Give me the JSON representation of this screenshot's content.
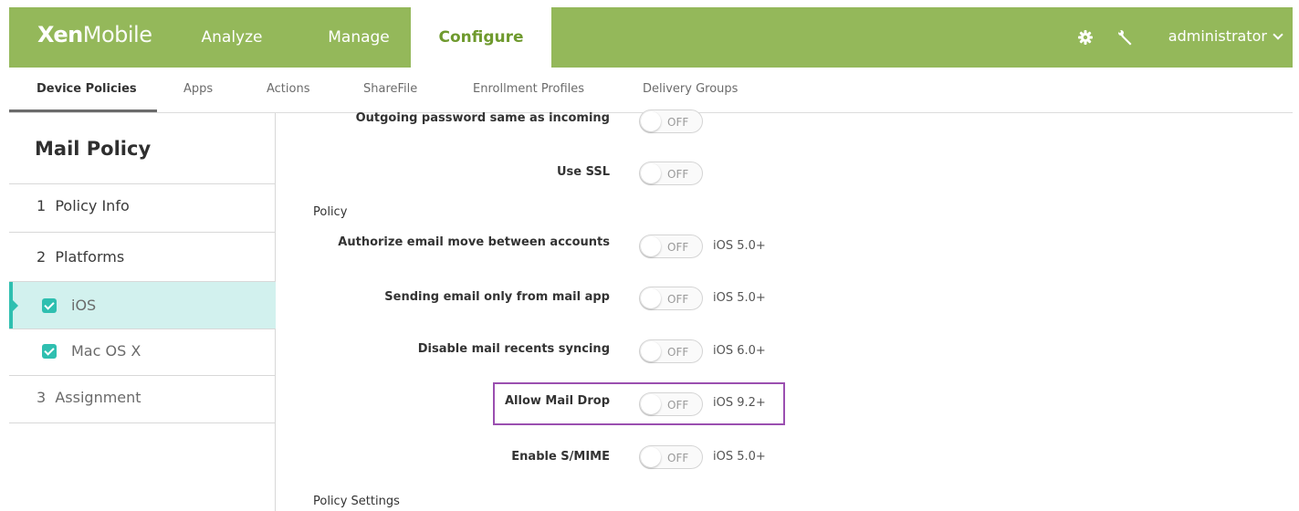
{
  "topbar": {
    "logo_bold": "Xen",
    "logo_light": "Mobile",
    "tabs": [
      {
        "label": "Analyze"
      },
      {
        "label": "Manage"
      },
      {
        "label": "Configure"
      }
    ],
    "user": "administrator",
    "icons": [
      "gear-icon",
      "wrench-icon"
    ],
    "color": "#94b85a"
  },
  "subnav": {
    "items": [
      {
        "label": "Device Policies"
      },
      {
        "label": "Apps"
      },
      {
        "label": "Actions"
      },
      {
        "label": "ShareFile"
      },
      {
        "label": "Enrollment Profiles"
      },
      {
        "label": "Delivery Groups"
      }
    ]
  },
  "sidebar": {
    "title": "Mail Policy",
    "items": [
      {
        "label": "1  Policy Info"
      },
      {
        "label": "2  Platforms"
      },
      {
        "label": "iOS",
        "checked": true
      },
      {
        "label": "Mac OS X",
        "checked": true
      },
      {
        "label": "3  Assignment"
      }
    ],
    "accent": "#2fbfb0"
  },
  "main": {
    "rows": [
      {
        "label": "Outgoing password same as incoming",
        "state": "OFF",
        "note": ""
      },
      {
        "label": "Use SSL",
        "state": "OFF",
        "note": ""
      },
      {
        "label": "Authorize email move between accounts",
        "state": "OFF",
        "note": "iOS 5.0+"
      },
      {
        "label": "Sending email only from mail app",
        "state": "OFF",
        "note": "iOS 5.0+"
      },
      {
        "label": "Disable mail recents syncing",
        "state": "OFF",
        "note": "iOS 6.0+"
      },
      {
        "label": "Allow Mail Drop",
        "state": "OFF",
        "note": "iOS 9.2+"
      },
      {
        "label": "Enable S/MIME",
        "state": "OFF",
        "note": "iOS 5.0+"
      }
    ],
    "section_policy": "Policy",
    "section_settings": "Policy Settings",
    "highlight_color": "#9b4fb0"
  }
}
